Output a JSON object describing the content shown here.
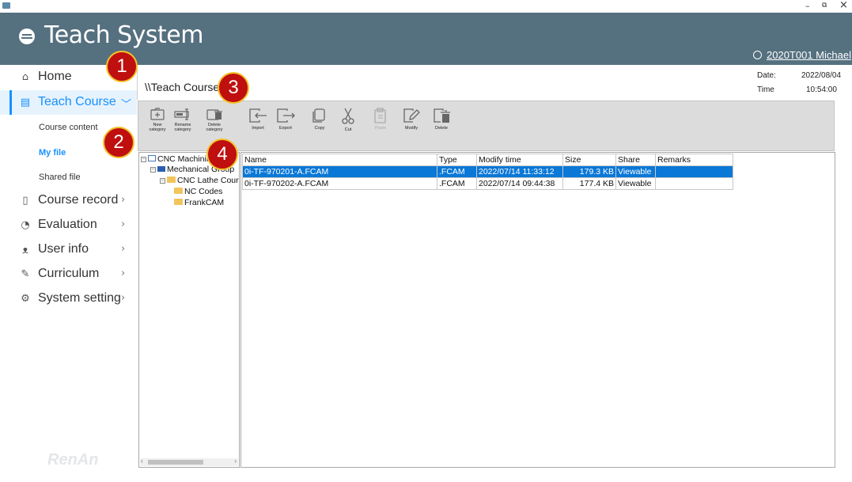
{
  "window": {
    "minimize": "–",
    "restore": "⧉",
    "close": "×"
  },
  "header": {
    "title": "Teach System",
    "user": "2020T001 Michael"
  },
  "sidebar": {
    "items": [
      {
        "label": "Home",
        "icon": "home-icon",
        "chevron": ""
      },
      {
        "label": "Teach Course",
        "icon": "book-icon",
        "chevron": "﹀"
      },
      {
        "label": "Course record",
        "icon": "document-icon",
        "chevron": "›"
      },
      {
        "label": "Evaluation",
        "icon": "clock-icon",
        "chevron": "›"
      },
      {
        "label": "User info",
        "icon": "user-icon",
        "chevron": "›"
      },
      {
        "label": "Curriculum",
        "icon": "pencil-icon",
        "chevron": "›"
      },
      {
        "label": "System setting",
        "icon": "gear-icon",
        "chevron": "›"
      }
    ],
    "sub_items": [
      "Course content",
      "My file",
      "Shared file"
    ],
    "brand": "RenAn"
  },
  "main": {
    "path": "\\\\Teach Course\\",
    "date_label": "Date:",
    "date_value": "2022/08/04",
    "time_label": "Time",
    "time_value": "10:54:00"
  },
  "toolbar": {
    "buttons": [
      {
        "line1": "New",
        "line2": "category"
      },
      {
        "line1": "Rename",
        "line2": "category"
      },
      {
        "line1": "Delete",
        "line2": "category"
      },
      {
        "line1": "Import"
      },
      {
        "line1": "Export"
      },
      {
        "line1": "Copy"
      },
      {
        "line1": "Cut"
      },
      {
        "line1": "Paste"
      },
      {
        "line1": "Modify"
      },
      {
        "line1": "Delete"
      }
    ]
  },
  "tree": {
    "nodes": [
      {
        "label": "CNC Machining",
        "expander": "⊟"
      },
      {
        "label": "Mechanical Group",
        "expander": "⊟"
      },
      {
        "label": "CNC Lathe Course",
        "expander": "⊟"
      },
      {
        "label": "NC Codes"
      },
      {
        "label": "FrankCAM"
      }
    ],
    "scroll_left": "‹",
    "scroll_right": "›"
  },
  "grid": {
    "columns": [
      "Name",
      "Type",
      "Modify time",
      "Size",
      "Share",
      "Remarks"
    ],
    "rows": [
      {
        "name": "0i-TF-970201-A.FCAM",
        "type": ".FCAM",
        "modified": "2022/07/14 11:33:12",
        "size": "179.3 KB",
        "share": "Viewable",
        "remarks": ""
      },
      {
        "name": "0i-TF-970202-A.FCAM",
        "type": ".FCAM",
        "modified": "2022/07/14 09:44:38",
        "size": "177.4 KB",
        "share": "Viewable",
        "remarks": ""
      }
    ]
  },
  "badges": [
    "1",
    "2",
    "3",
    "4"
  ],
  "colors": {
    "header": "#55707f",
    "accent": "#1890ff",
    "selection": "#0a78d7",
    "badge": "#bf0f0f",
    "badge_ring": "#f3c22a"
  }
}
